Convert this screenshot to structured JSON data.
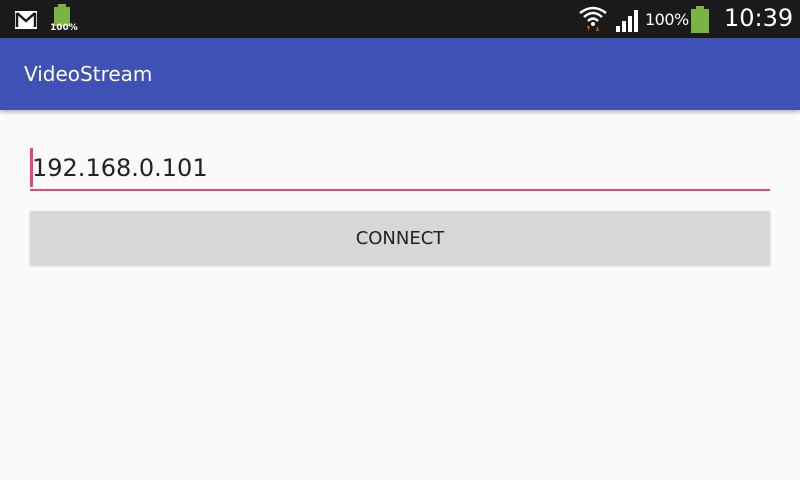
{
  "status_bar": {
    "battery_notification_text": "100%",
    "battery_percent": "100%",
    "clock": "10:39",
    "icons": [
      "gmail-icon",
      "battery-notification-icon",
      "wifi-icon",
      "signal-icon",
      "battery-icon"
    ]
  },
  "app_bar": {
    "title": "VideoStream"
  },
  "main": {
    "ip_input_value": "192.168.0.101",
    "connect_label": "CONNECT"
  },
  "colors": {
    "app_bar": "#3f51b5",
    "accent": "#e9447a",
    "button_bg": "#d6d7d7",
    "status_bar": "#1a1a1a",
    "battery_green": "#7cb342"
  }
}
